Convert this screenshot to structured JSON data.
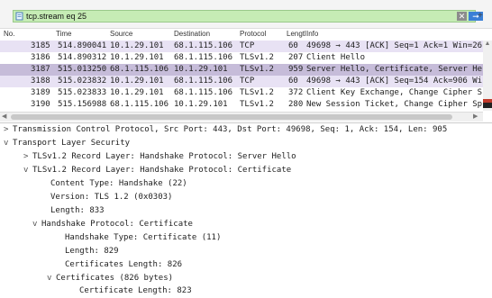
{
  "filter": {
    "value": "tcp.stream eq 25",
    "clear_icon": "clear-icon",
    "apply_icon": "arrow-right-icon",
    "expression_label": "+"
  },
  "columns": [
    "No.",
    "Time",
    "Source",
    "Destination",
    "Protocol",
    "Lengtl",
    "Info"
  ],
  "packets": [
    {
      "no": "3185",
      "time": "514.890041",
      "src": "10.1.29.101",
      "dst": "68.1.115.106",
      "proto": "TCP",
      "len": "60",
      "info": "49698 → 443 [ACK] Seq=1 Ack=1 Win=26"
    },
    {
      "no": "3186",
      "time": "514.890312",
      "src": "10.1.29.101",
      "dst": "68.1.115.106",
      "proto": "TLSv1.2",
      "len": "207",
      "info": "Client Hello"
    },
    {
      "no": "3187",
      "time": "515.013250",
      "src": "68.1.115.106",
      "dst": "10.1.29.101",
      "proto": "TLSv1.2",
      "len": "959",
      "info": "Server Hello, Certificate, Server He"
    },
    {
      "no": "3188",
      "time": "515.023832",
      "src": "10.1.29.101",
      "dst": "68.1.115.106",
      "proto": "TCP",
      "len": "60",
      "info": "49698 → 443 [ACK] Seq=154 Ack=906 Wi"
    },
    {
      "no": "3189",
      "time": "515.023833",
      "src": "10.1.29.101",
      "dst": "68.1.115.106",
      "proto": "TLSv1.2",
      "len": "372",
      "info": "Client Key Exchange, Change Cipher S"
    },
    {
      "no": "3190",
      "time": "515.156988",
      "src": "68.1.115.106",
      "dst": "10.1.29.101",
      "proto": "TLSv1.2",
      "len": "280",
      "info": "New Session Ticket, Change Cipher Sp"
    }
  ],
  "details": [
    {
      "indent": 0,
      "twisty": ">",
      "text": "Transmission Control Protocol, Src Port: 443, Dst Port: 49698, Seq: 1, Ack: 154, Len: 905"
    },
    {
      "indent": 0,
      "twisty": "v",
      "text": "Transport Layer Security"
    },
    {
      "indent": 1,
      "twisty": ">",
      "text": "TLSv1.2 Record Layer: Handshake Protocol: Server Hello"
    },
    {
      "indent": 1,
      "twisty": "v",
      "text": "TLSv1.2 Record Layer: Handshake Protocol: Certificate"
    },
    {
      "indent": 2,
      "twisty": "",
      "text": "Content Type: Handshake (22)"
    },
    {
      "indent": 2,
      "twisty": "",
      "text": "Version: TLS 1.2 (0x0303)"
    },
    {
      "indent": 2,
      "twisty": "",
      "text": "Length: 833"
    },
    {
      "indent": 2,
      "twisty": "v",
      "text": "Handshake Protocol: Certificate"
    },
    {
      "indent": 3,
      "twisty": "",
      "text": "Handshake Type: Certificate (11)"
    },
    {
      "indent": 3,
      "twisty": "",
      "text": "Length: 829"
    },
    {
      "indent": 3,
      "twisty": "",
      "text": "Certificates Length: 826"
    },
    {
      "indent": 3,
      "twisty": "v",
      "text": "Certificates (826 bytes)"
    },
    {
      "indent": 4,
      "twisty": "",
      "text": "Certificate Length: 823"
    }
  ],
  "colors": {
    "filter_ok": "#c6ecb5",
    "row_tcp": "#e8e2f4",
    "row_selected": "#c6bcd9"
  }
}
